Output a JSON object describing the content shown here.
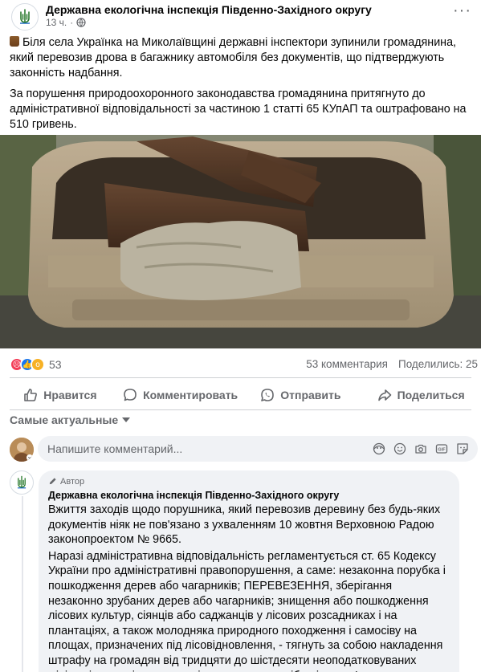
{
  "post": {
    "page_name": "Державна екологічна інспекція Південно-Західного округу",
    "time": "13 ч.",
    "paragraph1": "Біля села Українка на Миколаївщині державні інспектори зупинили громадянина, який перевозив дрова в багажнику автомобіля без документів, що підтверджують законність надбання.",
    "paragraph2": "За порушення природоохоронного законодавства громадянина притягнуто до адміністративної відповідальності за частиною 1 статті 65 КУпАП та оштрафовано на 510 гривень.",
    "emoji_icon": "firewood-emoji"
  },
  "engagement": {
    "reaction_count": "53",
    "comments": "53 комментария",
    "shares": "Поделились: 25",
    "reactions": [
      "angry",
      "like",
      "wow"
    ],
    "colors": {
      "angry": "#f33e58",
      "like": "#1877f2",
      "wow": "#f7b125"
    }
  },
  "actions": {
    "like": "Нравится",
    "comment": "Комментировать",
    "send": "Отправить",
    "share": "Поделиться"
  },
  "comments_section": {
    "sort_label": "Самые актуальные",
    "input_placeholder": "Напишите комментарий...",
    "input_icons": [
      "avatar-sticker-icon",
      "emoji-icon",
      "camera-icon",
      "gif-icon",
      "sticker-icon"
    ]
  },
  "reply": {
    "badge": "Автор",
    "author": "Державна екологічна інспекція Південно-Західного округу",
    "paragraph1": "Вжиття заходів щодо порушника, який перевозив деревину без будь-яких документів ніяк не пов'язано з ухваленням 10 жовтня Верховною Радою законопроектом № 9665.",
    "paragraph2": "Наразі адміністративна відповідальність регламентується ст. 65 Кодексу України про адміністративні правопорушення, а саме: незаконна порубка і пошкодження дерев або чагарників; ПЕРЕВЕЗЕННЯ, зберігання незаконно зрубаних дерев або чагарників; знищення або пошкодження лісових культур, сіянців або саджанців у лісових розсадниках і на плантаціях, а також молодняка природного походження і самосіву на площах, призначених під лісовідновлення, - тягнуть за собою накладення штрафу на громадян від тридцяти до шістдесяти неоподатковуваних мінімумів доходів громадян і на посадових осіб - від ста п'ятдесяти до трьохсот неоподатковуваних мінімумів"
  },
  "theme": {
    "text": "#050505",
    "secondary": "#65676b",
    "accent": "#1877f2",
    "bubble": "#f0f2f5"
  }
}
